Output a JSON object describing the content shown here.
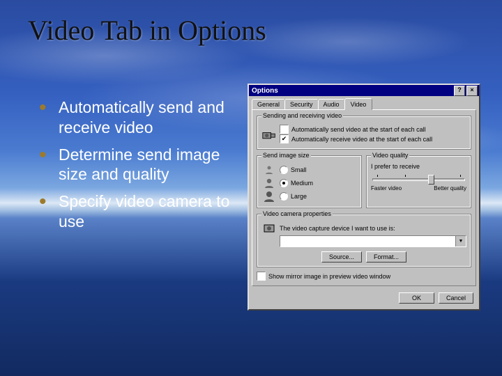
{
  "title": "Video Tab in Options",
  "bullets": [
    "Automatically send and receive video",
    "Determine send image size and quality",
    "Specify video camera to use"
  ],
  "dialog": {
    "title": "Options",
    "help_glyph": "?",
    "close_glyph": "×",
    "tabs": {
      "t0": "General",
      "t1": "Security",
      "t2": "Audio",
      "t3": "Video"
    },
    "group1": {
      "legend": "Sending and receiving video",
      "cb1": "Automatically send video at the start of each call",
      "cb2": "Automatically receive video at the start of each call"
    },
    "group2": {
      "legend": "Send image size",
      "r1": "Small",
      "r2": "Medium",
      "r3": "Large"
    },
    "group3": {
      "legend": "Video quality",
      "desc": "I prefer to receive",
      "left": "Faster video",
      "right": "Better quality"
    },
    "group4": {
      "legend": "Video camera properties",
      "desc": "The video capture device I want to use is:",
      "combo": "",
      "source": "Source...",
      "format": "Format..."
    },
    "mirror": "Show mirror image in preview video window",
    "ok": "OK",
    "cancel": "Cancel"
  }
}
